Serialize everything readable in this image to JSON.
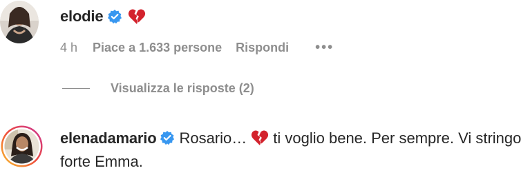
{
  "comment1": {
    "username": "elodie",
    "verified_icon": "verified-badge-icon",
    "emoji_icon": "broken-heart-icon",
    "time": "4 h",
    "likes": "Piace a 1.633 persone",
    "reply_label": "Rispondi",
    "more_label": "•••"
  },
  "replies": {
    "label": "Visualizza le risposte (2)"
  },
  "comment2": {
    "username": "elenadamario",
    "verified_icon": "verified-badge-icon",
    "text_before": "Rosario…",
    "emoji_icon": "broken-heart-icon",
    "text_after": "ti voglio bene. Per sempre. Vi stringo forte Emma."
  },
  "colors": {
    "text": "#262626",
    "secondary": "#8e8e8e",
    "verified": "#3897f0",
    "heart": "#d3232d",
    "story_ring_start": "#f9c42b",
    "story_ring_end": "#c9349a"
  }
}
